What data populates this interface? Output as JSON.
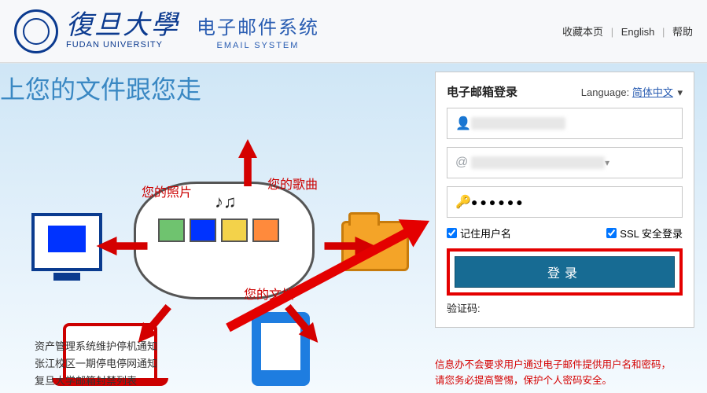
{
  "header": {
    "uni_cn": "復旦大學",
    "uni_en": "FUDAN UNIVERSITY",
    "sys_cn": "电子邮件系统",
    "sys_en": "EMAIL SYSTEM",
    "links": {
      "fav": "收藏本页",
      "english": "English",
      "help": "帮助"
    }
  },
  "slogan": "上您的文件跟您走",
  "illus_labels": {
    "photos": "您的照片",
    "songs": "您的歌曲",
    "docs": "您的文档"
  },
  "notices": [
    "资产管理系统维护停机通知",
    "张江校区一期停电停网通知",
    "复旦大学邮箱封禁列表"
  ],
  "login": {
    "title": "电子邮箱登录",
    "language_label": "Language:",
    "language_value": "简体中文",
    "password_dots": "●●●●●●",
    "remember": "记住用户名",
    "ssl": "SSL 安全登录",
    "button": "登录",
    "vcode_partial": "验证码:"
  },
  "warning_lines": [
    "信息办不会要求用户通过电子邮件提供用户名和密码，",
    "请您务必提高警惕，保护个人密码安全。"
  ],
  "icons": {
    "user": "👤",
    "at": "@",
    "key": "🔑",
    "caret": "▾"
  }
}
